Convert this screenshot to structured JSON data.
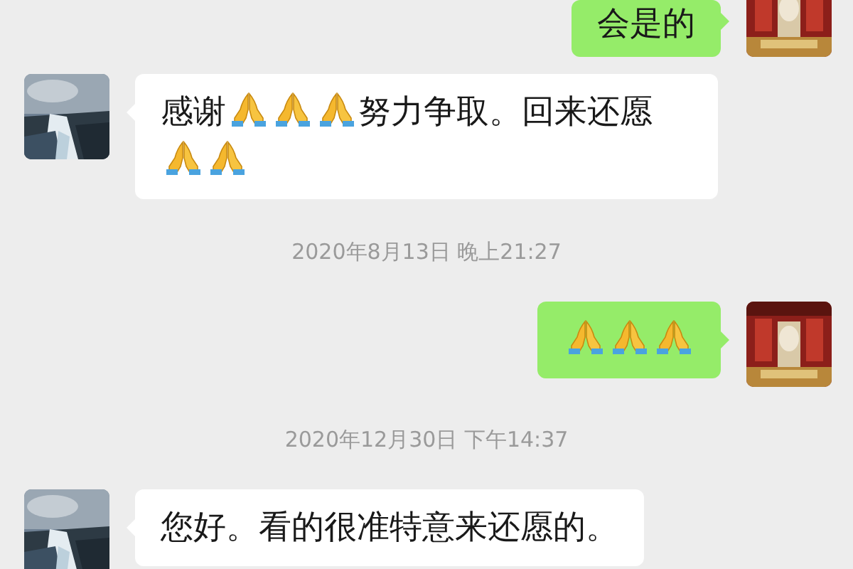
{
  "chat": [
    {
      "kind": "message",
      "outgoing": true,
      "parts": [
        {
          "kind": "text",
          "text": "会是的"
        }
      ]
    },
    {
      "kind": "message",
      "outgoing": false,
      "parts": [
        {
          "kind": "text",
          "text": "感谢"
        },
        {
          "kind": "emoji"
        },
        {
          "kind": "emoji"
        },
        {
          "kind": "emoji"
        },
        {
          "kind": "text",
          "text": "努力争取。回来还愿"
        },
        {
          "kind": "emoji"
        },
        {
          "kind": "emoji"
        }
      ]
    },
    {
      "kind": "timestamp",
      "text": "2020年8月13日 晚上21:27"
    },
    {
      "kind": "message",
      "outgoing": true,
      "parts": [
        {
          "kind": "emoji"
        },
        {
          "kind": "emoji"
        },
        {
          "kind": "emoji"
        }
      ]
    },
    {
      "kind": "timestamp",
      "text": "2020年12月30日 下午14:37"
    },
    {
      "kind": "message",
      "outgoing": false,
      "parts": [
        {
          "kind": "text",
          "text": "您好。看的很准特意来还愿的。"
        }
      ]
    }
  ]
}
